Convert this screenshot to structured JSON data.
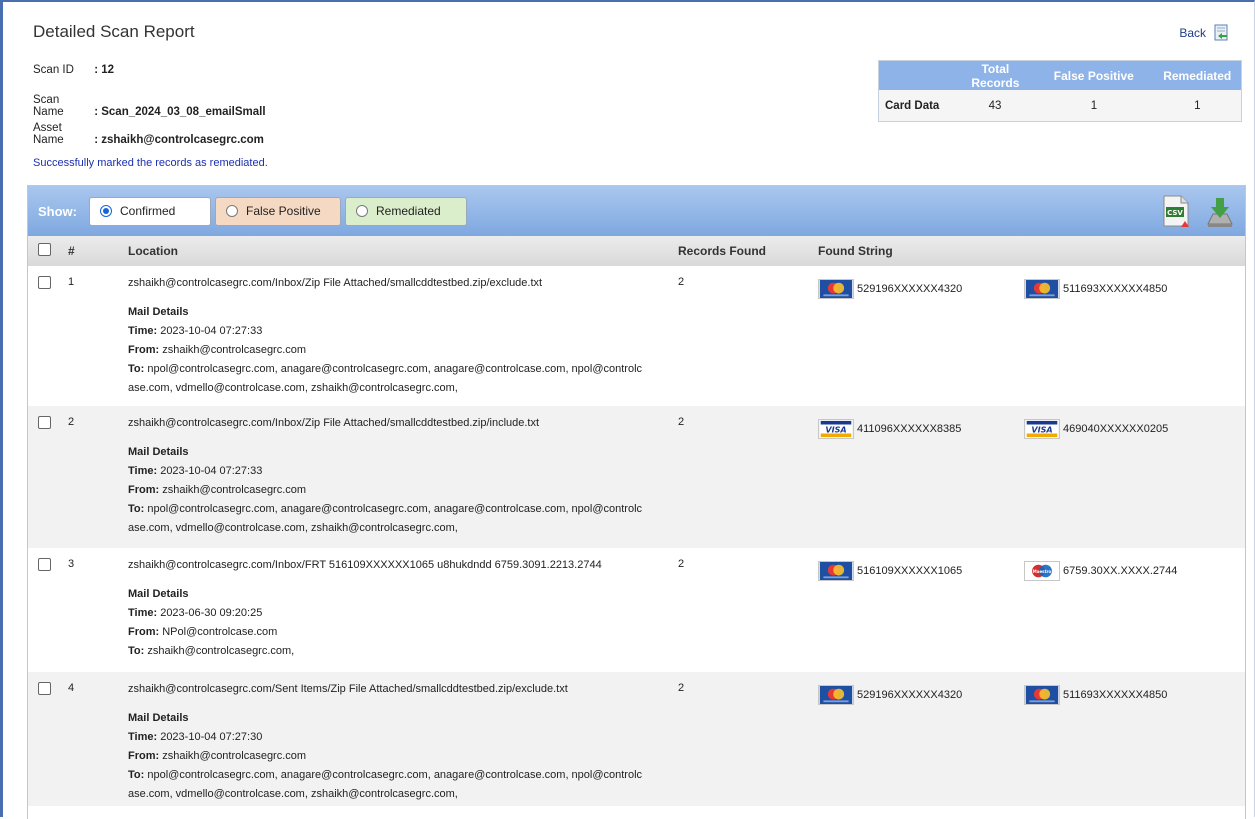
{
  "page": {
    "title": "Detailed Scan Report",
    "back_label": "Back"
  },
  "scan_info": {
    "scan_id_label": "Scan ID",
    "scan_id_value": ": 12",
    "scan_name_label": "Scan Name",
    "scan_name_value": ": Scan_2024_03_08_emailSmall",
    "asset_name_label": "Asset Name",
    "asset_name_value": ": zshaikh@controlcasegrc.com"
  },
  "summary": {
    "headers": [
      "",
      "Total Records",
      "False Positive",
      "Remediated"
    ],
    "row": {
      "label": "Card Data",
      "total": "43",
      "false_positive": "1",
      "remediated": "1"
    }
  },
  "message": "Successfully marked the records as remediated.",
  "toolbar": {
    "show_label": "Show:",
    "filters": [
      {
        "label": "Confirmed",
        "selected": true,
        "bg": "#ffffff"
      },
      {
        "label": "False Positive",
        "selected": false,
        "bg": "#f6d9c3"
      },
      {
        "label": "Remediated",
        "selected": false,
        "bg": "#dbeecb"
      }
    ],
    "icons": [
      "csv-export-icon",
      "download-icon"
    ]
  },
  "table": {
    "headers": {
      "num": "#",
      "location": "Location",
      "records": "Records Found",
      "found": "Found String"
    },
    "rows": [
      {
        "num": "1",
        "location": "zshaikh@controlcasegrc.com/Inbox/Zip File Attached/smallcddtestbed.zip/exclude.txt",
        "mail_details": "Mail Details",
        "time_label": "Time:",
        "time": " 2023-10-04 07:27:33",
        "from_label": "From:",
        "from": " zshaikh@controlcasegrc.com",
        "to_label": "To:",
        "to": " npol@controlcasegrc.com, anagare@controlcasegrc.com, anagare@controlcase.com, npol@controlc ase.com, vdmello@controlcase.com, zshaikh@controlcasegrc.com,",
        "records": "2",
        "cards": [
          {
            "brand": "mastercard",
            "value": "529196XXXXXX4320"
          },
          {
            "brand": "mastercard",
            "value": "511693XXXXXX4850"
          }
        ]
      },
      {
        "num": "2",
        "location": "zshaikh@controlcasegrc.com/Inbox/Zip File Attached/smallcddtestbed.zip/include.txt",
        "mail_details": "Mail Details",
        "time_label": "Time:",
        "time": " 2023-10-04 07:27:33",
        "from_label": "From:",
        "from": " zshaikh@controlcasegrc.com",
        "to_label": "To:",
        "to": " npol@controlcasegrc.com, anagare@controlcasegrc.com, anagare@controlcase.com, npol@controlc ase.com, vdmello@controlcase.com, zshaikh@controlcasegrc.com,",
        "records": "2",
        "cards": [
          {
            "brand": "visa",
            "value": "411096XXXXXX8385"
          },
          {
            "brand": "visa",
            "value": "469040XXXXXX0205"
          }
        ]
      },
      {
        "num": "3",
        "location": "zshaikh@controlcasegrc.com/Inbox/FRT 516109XXXXXX1065 u8hukdndd 6759.3091.2213.2744",
        "mail_details": "Mail Details",
        "time_label": "Time:",
        "time": " 2023-06-30 09:20:25",
        "from_label": "From:",
        "from": " NPol@controlcase.com",
        "to_label": "To:",
        "to": " zshaikh@controlcasegrc.com,",
        "records": "2",
        "cards": [
          {
            "brand": "mastercard",
            "value": "516109XXXXXX1065"
          },
          {
            "brand": "maestro",
            "value": "6759.30XX.XXXX.2744"
          }
        ]
      },
      {
        "num": "4",
        "location": "zshaikh@controlcasegrc.com/Sent Items/Zip File Attached/smallcddtestbed.zip/exclude.txt",
        "mail_details": "Mail Details",
        "time_label": "Time:",
        "time": " 2023-10-04 07:27:30",
        "from_label": "From:",
        "from": " zshaikh@controlcasegrc.com",
        "to_label": "To:",
        "to": " npol@controlcasegrc.com, anagare@controlcasegrc.com, anagare@controlcase.com, npol@controlc ase.com, vdmello@controlcase.com, zshaikh@controlcasegrc.com,",
        "records": "2",
        "cards": [
          {
            "brand": "mastercard",
            "value": "529196XXXXXX4320"
          },
          {
            "brand": "mastercard",
            "value": "511693XXXXXX4850"
          }
        ]
      }
    ]
  }
}
